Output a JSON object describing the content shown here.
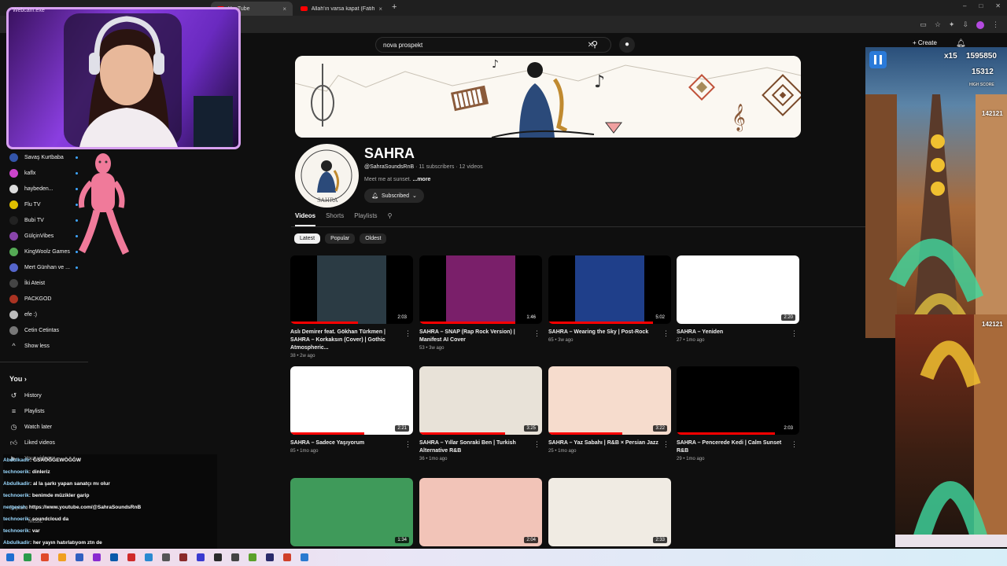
{
  "browser": {
    "tabs": [
      {
        "label": "YouTube",
        "active": true
      },
      {
        "label": "Allah'ın varsa kapat (Fatih abi...)",
        "active": false
      }
    ]
  },
  "youtube": {
    "search": {
      "value": "nova prospekt"
    },
    "create_label": "Create",
    "channel": {
      "name": "SAHRA",
      "handle": "@SahraSoundsRnB",
      "subscribers": "11 subscribers",
      "videos_count": "12 videos",
      "description": "Meet me at sunset.",
      "more_label": "...more",
      "subscribe_label": "Subscribed",
      "tabs": [
        "Videos",
        "Shorts",
        "Playlists"
      ],
      "chips": [
        "Latest",
        "Popular",
        "Oldest"
      ]
    },
    "videos": [
      {
        "title": "Aslı Demirer feat. Gökhan Türkmen | SAHRA – Korkaksın (Cover) | Gothic Atmospheric...",
        "meta": "38 • 2w ago",
        "duration": "2:03",
        "color": "#2b3b44"
      },
      {
        "title": "SAHRA – SNAP (Rap Rock Version) | Manifest AI Cover",
        "meta": "53 • 3w ago",
        "duration": "1:46",
        "color": "#7a1f6a"
      },
      {
        "title": "SAHRA – Wearing the Sky | Post-Rock",
        "meta": "65 • 3w ago",
        "duration": "5:02",
        "color": "#1f3f8a"
      },
      {
        "title": "SAHRA – Yeniden",
        "meta": "27 • 1mo ago",
        "duration": "2:20",
        "color": "#ffffff"
      },
      {
        "title": "SAHRA – Sadece Yaşıyorum",
        "meta": "85 • 1mo ago",
        "duration": "2:21",
        "color": "#ffffff"
      },
      {
        "title": "SAHRA – Yıllar Sonraki Ben | Turkish Alternative R&B",
        "meta": "36 • 1mo ago",
        "duration": "3:25",
        "color": "#e8e2d8"
      },
      {
        "title": "SAHRA – Yaz Sabahı | R&B × Persian Jazz",
        "meta": "25 • 1mo ago",
        "duration": "3:22",
        "color": "#f6dccd"
      },
      {
        "title": "SAHRA – Pencerede Kedi | Calm Sunset R&B",
        "meta": "29 • 1mo ago",
        "duration": "2:03",
        "color": "#000000"
      },
      {
        "title": "",
        "meta": "",
        "duration": "1:34",
        "color": "#3f9a5a"
      },
      {
        "title": "",
        "meta": "",
        "duration": "2:04",
        "color": "#f2c4b8"
      },
      {
        "title": "",
        "meta": "",
        "duration": "2:33",
        "color": "#f0ebe3"
      }
    ],
    "sidebar": {
      "subscriptions": [
        {
          "label": "Savaş Kurtbaba",
          "color": "#3355aa"
        },
        {
          "label": "kaflx",
          "color": "#cc44cc"
        },
        {
          "label": "haybeden...",
          "color": "#dddddd"
        },
        {
          "label": "Flu TV",
          "color": "#e0c000"
        },
        {
          "label": "Bubi TV",
          "color": "#222222"
        },
        {
          "label": "GülçinVibes",
          "color": "#8844aa"
        },
        {
          "label": "KingWoolz Games",
          "color": "#55aa55"
        },
        {
          "label": "Mert Günhan ve ...",
          "color": "#5566cc"
        },
        {
          "label": "İki Ateist",
          "color": "#444444"
        },
        {
          "label": "PACKGOD",
          "color": "#aa3322"
        },
        {
          "label": "efe :)",
          "color": "#bbbbbb"
        },
        {
          "label": "Cetin Cetintas",
          "color": "#777777"
        }
      ],
      "show_less": "Show less",
      "you_header": "You",
      "you_items": [
        "History",
        "Playlists",
        "Watch later",
        "Liked videos",
        "Your videos"
      ],
      "explore": "Explore",
      "music": "Music"
    }
  },
  "stream": {
    "webcam_label": "Webcam.exe",
    "chat": [
      {
        "user": "Abdulkadir",
        "msg": "ĞSAÖĞĞEWÖĞĞW"
      },
      {
        "user": "technoerik",
        "msg": "dinleriz"
      },
      {
        "user": "Abdulkadir",
        "msg": "al la şarkı yapan sanatçı mı olur"
      },
      {
        "user": "technoerik",
        "msg": "benimde müzikler garip"
      },
      {
        "user": "nergeesh",
        "msg": "https://www.youtube.com/@SahraSoundsRnB"
      },
      {
        "user": "technoerik",
        "msg": "soundcloud da"
      },
      {
        "user": "technoerik",
        "msg": "var"
      },
      {
        "user": "Abdulkadir",
        "msg": "her yayın hatırlatıyom ztn de"
      },
      {
        "user": "Abdulkadir",
        "msg": "manipule olmuyor artık"
      }
    ],
    "game": {
      "multiplier": "x15",
      "score": "1595850",
      "coins": "15312",
      "high_score_label": "HIGH SCORE",
      "high_score": "142121",
      "high_score_2": "142121"
    }
  }
}
